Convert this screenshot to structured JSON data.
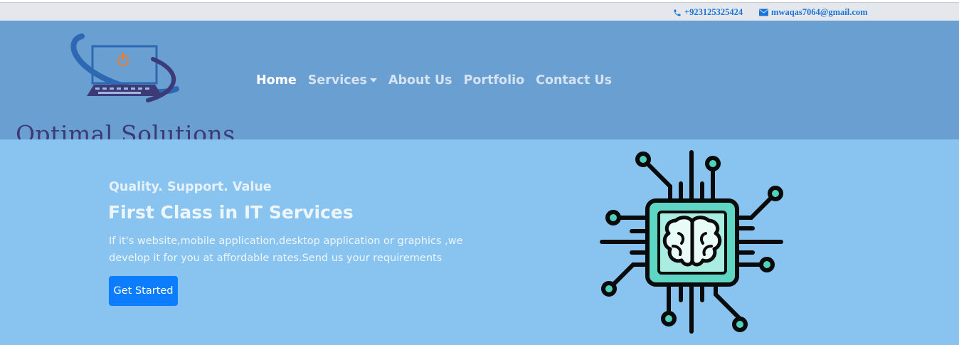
{
  "topbar": {
    "phone": "+923125325424",
    "email": "mwaqas7064@gmail.com",
    "phone_icon": "phone-icon",
    "email_icon": "envelope-icon"
  },
  "brand": {
    "name": "Optimal Solutions",
    "logo_icon": "laptop-power-logo"
  },
  "nav": {
    "items": [
      {
        "label": "Home",
        "active": true
      },
      {
        "label": "Services",
        "dropdown": true
      },
      {
        "label": "About Us"
      },
      {
        "label": "Portfolio"
      },
      {
        "label": "Contact Us"
      }
    ]
  },
  "hero": {
    "tagline": "Quality. Support. Value",
    "headline": "First Class in IT Services",
    "description": "If it's website,mobile application,desktop application or graphics ,we develop it for you at affordable rates.Send us your requirements",
    "cta_label": "Get Started",
    "illustration_icon": "ai-chip-brain-icon"
  },
  "colors": {
    "topbar": "#e4e7eb",
    "navbar": "#699fd1",
    "hero": "#88c4ef",
    "button": "#0d7dff",
    "contact_text": "#1a73d9",
    "brand_text": "#3d3a78"
  }
}
